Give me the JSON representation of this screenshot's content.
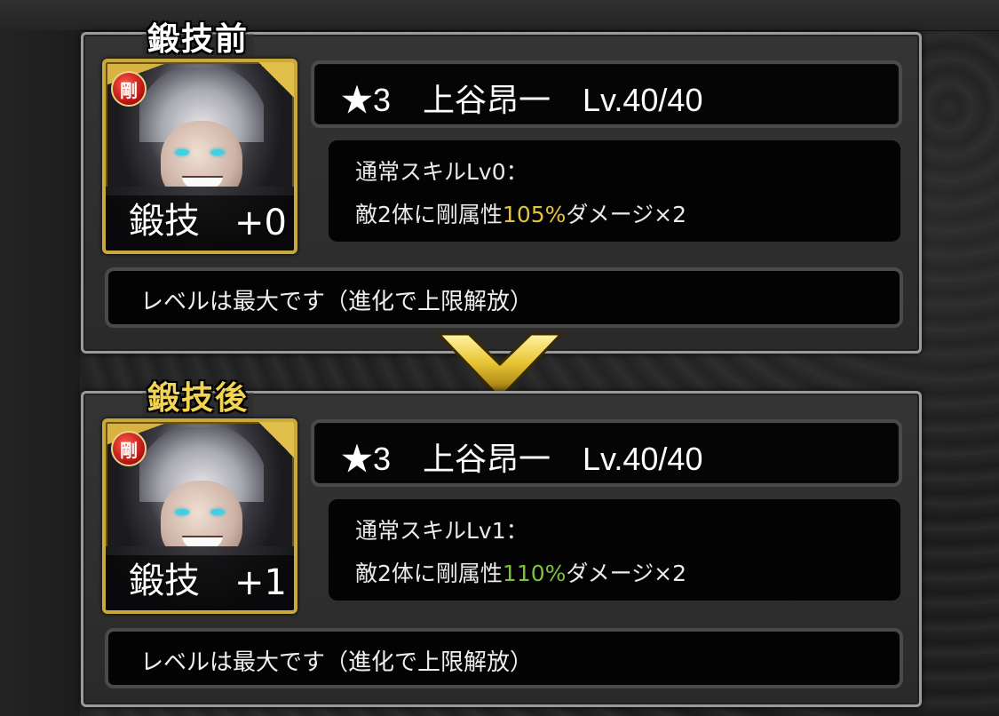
{
  "colors": {
    "gold_accent": "#f3d452",
    "skill_highlight_before": "#e2c43b",
    "skill_highlight_after": "#7cc23b",
    "panel_border": "#9a9a9a"
  },
  "before": {
    "section_title": "鍛技前",
    "attribute_badge": "剛",
    "forge_label": "鍛技",
    "forge_value": "+0",
    "name_line": "★3　上谷昂一　Lv.40/40",
    "skill_heading": "通常スキルLv0：",
    "skill_desc_prefix": "敵2体に剛属性",
    "skill_desc_value": "105%",
    "skill_desc_suffix": "ダメージ×2",
    "level_message": "レベルは最大です（進化で上限解放）"
  },
  "arrow_icon": "chevron-down-icon",
  "after": {
    "section_title": "鍛技後",
    "attribute_badge": "剛",
    "forge_label": "鍛技",
    "forge_value": "+1",
    "name_line": "★3　上谷昂一　Lv.40/40",
    "skill_heading": "通常スキルLv1：",
    "skill_desc_prefix": "敵2体に剛属性",
    "skill_desc_value": "110%",
    "skill_desc_suffix": "ダメージ×2",
    "level_message": "レベルは最大です（進化で上限解放）"
  }
}
